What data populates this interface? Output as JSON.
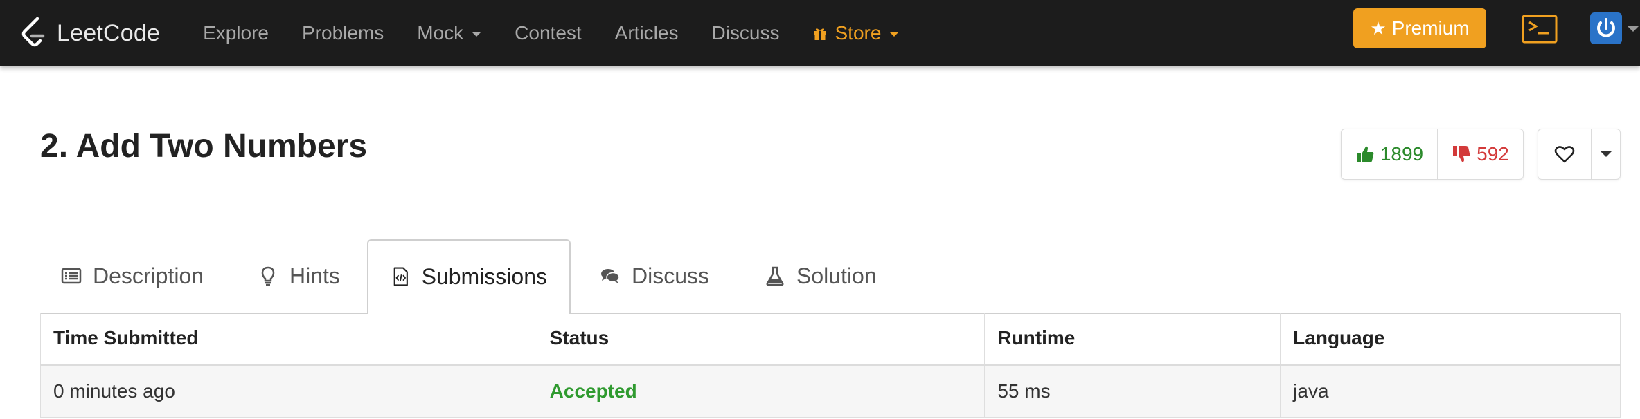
{
  "navbar": {
    "brand": "LeetCode",
    "links": [
      {
        "label": "Explore"
      },
      {
        "label": "Problems"
      },
      {
        "label": "Mock"
      },
      {
        "label": "Contest"
      },
      {
        "label": "Articles"
      },
      {
        "label": "Discuss"
      },
      {
        "label": "Store"
      }
    ],
    "premium_label": "Premium",
    "accent_color": "#f0a020",
    "background_color": "#1c1c1c"
  },
  "problem": {
    "title": "2. Add Two Numbers",
    "likes": "1899",
    "dislikes": "592"
  },
  "tabs": [
    {
      "label": "Description",
      "icon": "description-icon"
    },
    {
      "label": "Hints",
      "icon": "lightbulb-icon"
    },
    {
      "label": "Submissions",
      "icon": "code-file-icon",
      "active": true
    },
    {
      "label": "Discuss",
      "icon": "comments-icon"
    },
    {
      "label": "Solution",
      "icon": "flask-icon"
    }
  ],
  "submissions": {
    "headers": [
      "Time Submitted",
      "Status",
      "Runtime",
      "Language"
    ],
    "rows": [
      {
        "time": "0 minutes ago",
        "status": "Accepted",
        "runtime": "55 ms",
        "language": "java"
      }
    ],
    "status_color": "#2f9a2f"
  }
}
